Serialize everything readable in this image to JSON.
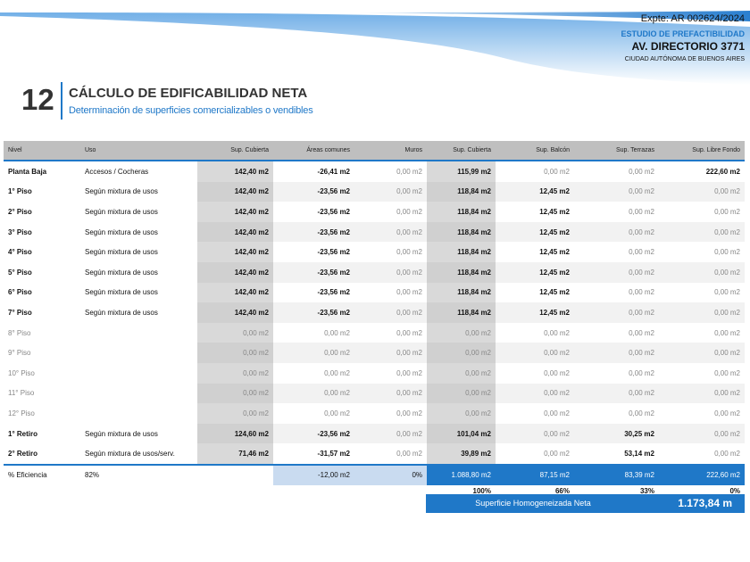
{
  "header": {
    "expte": "Expte: AR 002624/2024",
    "estudio": "ESTUDIO DE PREFACTIBILIDAD",
    "street": "AV. DIRECTORIO 3771",
    "city": "CIUDAD AUTÓNOMA DE BUENOS AIRES"
  },
  "section": {
    "number": "12",
    "title": "CÁLCULO DE EDIFICABILIDAD NETA",
    "subtitle": "Determinación de superficies comercializables o vendibles"
  },
  "colors": {
    "accent": "#1f78c8",
    "header_gray": "#bfbfbf",
    "light_blue": "#c9dbf0"
  },
  "table": {
    "columns": [
      "Nivel",
      "Uso",
      "Sup. Cubierta",
      "Áreas comunes",
      "Muros",
      "Sup. Cubierta",
      "Sup. Balcón",
      "Sup. Terrazas",
      "Sup. Libre Fondo"
    ],
    "rows": [
      [
        "Planta Baja",
        "Accesos / Cocheras",
        "142,40 m2",
        "-26,41 m2",
        "0,00 m2",
        "115,99 m2",
        "0,00 m2",
        "0,00 m2",
        "222,60 m2"
      ],
      [
        "1° Piso",
        "Según mixtura de usos",
        "142,40 m2",
        "-23,56 m2",
        "0,00 m2",
        "118,84 m2",
        "12,45 m2",
        "0,00 m2",
        "0,00 m2"
      ],
      [
        "2° Piso",
        "Según mixtura de usos",
        "142,40 m2",
        "-23,56 m2",
        "0,00 m2",
        "118,84 m2",
        "12,45 m2",
        "0,00 m2",
        "0,00 m2"
      ],
      [
        "3° Piso",
        "Según mixtura de usos",
        "142,40 m2",
        "-23,56 m2",
        "0,00 m2",
        "118,84 m2",
        "12,45 m2",
        "0,00 m2",
        "0,00 m2"
      ],
      [
        "4° Piso",
        "Según mixtura de usos",
        "142,40 m2",
        "-23,56 m2",
        "0,00 m2",
        "118,84 m2",
        "12,45 m2",
        "0,00 m2",
        "0,00 m2"
      ],
      [
        "5° Piso",
        "Según mixtura de usos",
        "142,40 m2",
        "-23,56 m2",
        "0,00 m2",
        "118,84 m2",
        "12,45 m2",
        "0,00 m2",
        "0,00 m2"
      ],
      [
        "6° Piso",
        "Según mixtura de usos",
        "142,40 m2",
        "-23,56 m2",
        "0,00 m2",
        "118,84 m2",
        "12,45 m2",
        "0,00 m2",
        "0,00 m2"
      ],
      [
        "7° Piso",
        "Según mixtura de usos",
        "142,40 m2",
        "-23,56 m2",
        "0,00 m2",
        "118,84 m2",
        "12,45 m2",
        "0,00 m2",
        "0,00 m2"
      ],
      [
        "8° Piso",
        "",
        "0,00 m2",
        "0,00 m2",
        "0,00 m2",
        "0,00 m2",
        "0,00 m2",
        "0,00 m2",
        "0,00 m2"
      ],
      [
        "9° Piso",
        "",
        "0,00 m2",
        "0,00 m2",
        "0,00 m2",
        "0,00 m2",
        "0,00 m2",
        "0,00 m2",
        "0,00 m2"
      ],
      [
        "10° Piso",
        "",
        "0,00 m2",
        "0,00 m2",
        "0,00 m2",
        "0,00 m2",
        "0,00 m2",
        "0,00 m2",
        "0,00 m2"
      ],
      [
        "11° Piso",
        "",
        "0,00 m2",
        "0,00 m2",
        "0,00 m2",
        "0,00 m2",
        "0,00 m2",
        "0,00 m2",
        "0,00 m2"
      ],
      [
        "12° Piso",
        "",
        "0,00 m2",
        "0,00 m2",
        "0,00 m2",
        "0,00 m2",
        "0,00 m2",
        "0,00 m2",
        "0,00 m2"
      ],
      [
        "1° Retiro",
        "Según mixtura de usos",
        "124,60 m2",
        "-23,56 m2",
        "0,00 m2",
        "101,04 m2",
        "0,00 m2",
        "30,25 m2",
        "0,00 m2"
      ],
      [
        "2° Retiro",
        "Según mixtura de usos/serv.",
        "71,46 m2",
        "-31,57 m2",
        "0,00 m2",
        "39,89 m2",
        "0,00 m2",
        "53,14 m2",
        "0,00 m2"
      ]
    ],
    "totals": {
      "label": "% Eficiencia",
      "efficiency": "82%",
      "areas_comunes": "-12,00 m2",
      "muros": "0%",
      "sup_cubierta": "1.088,80 m2",
      "sup_balcon": "87,15 m2",
      "sup_terrazas": "83,39 m2",
      "sup_libre": "222,60 m2"
    },
    "percentages": {
      "sup_cubierta": "100%",
      "sup_balcon": "66%",
      "sup_terrazas": "33%",
      "sup_libre": "0%"
    }
  },
  "homogeneizada": {
    "label": "Superficie Homogeneizada Neta",
    "value": "1.173,84 m"
  }
}
